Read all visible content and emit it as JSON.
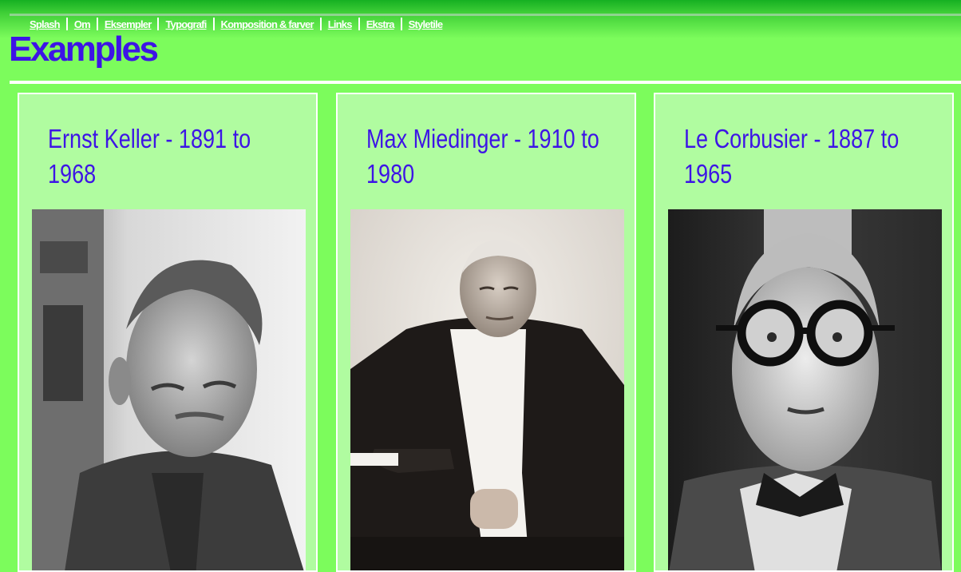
{
  "nav": {
    "items": [
      {
        "label": "Splash"
      },
      {
        "label": "Om"
      },
      {
        "label": "Eksempler"
      },
      {
        "label": "Typografi"
      },
      {
        "label": "Komposition & farver"
      },
      {
        "label": "Links"
      },
      {
        "label": "Ekstra"
      },
      {
        "label": "Styletile"
      }
    ]
  },
  "page": {
    "title": "Examples"
  },
  "cards": [
    {
      "heading_line1": "Ernst Keller - 1891 to",
      "heading_line2": "1968",
      "photo": "portrait-ernst-keller"
    },
    {
      "heading_line1": "Max Miedinger - 1910 to",
      "heading_line2": "1980",
      "photo": "portrait-max-miedinger"
    },
    {
      "heading_line1": "Le Corbusier - 1887 to",
      "heading_line2": "1965",
      "photo": "portrait-le-corbusier"
    }
  ],
  "colors": {
    "background": "#7cfc5c",
    "card_background": "#b0fca0",
    "heading": "#3d14e6",
    "nav_text": "#ffffff"
  }
}
